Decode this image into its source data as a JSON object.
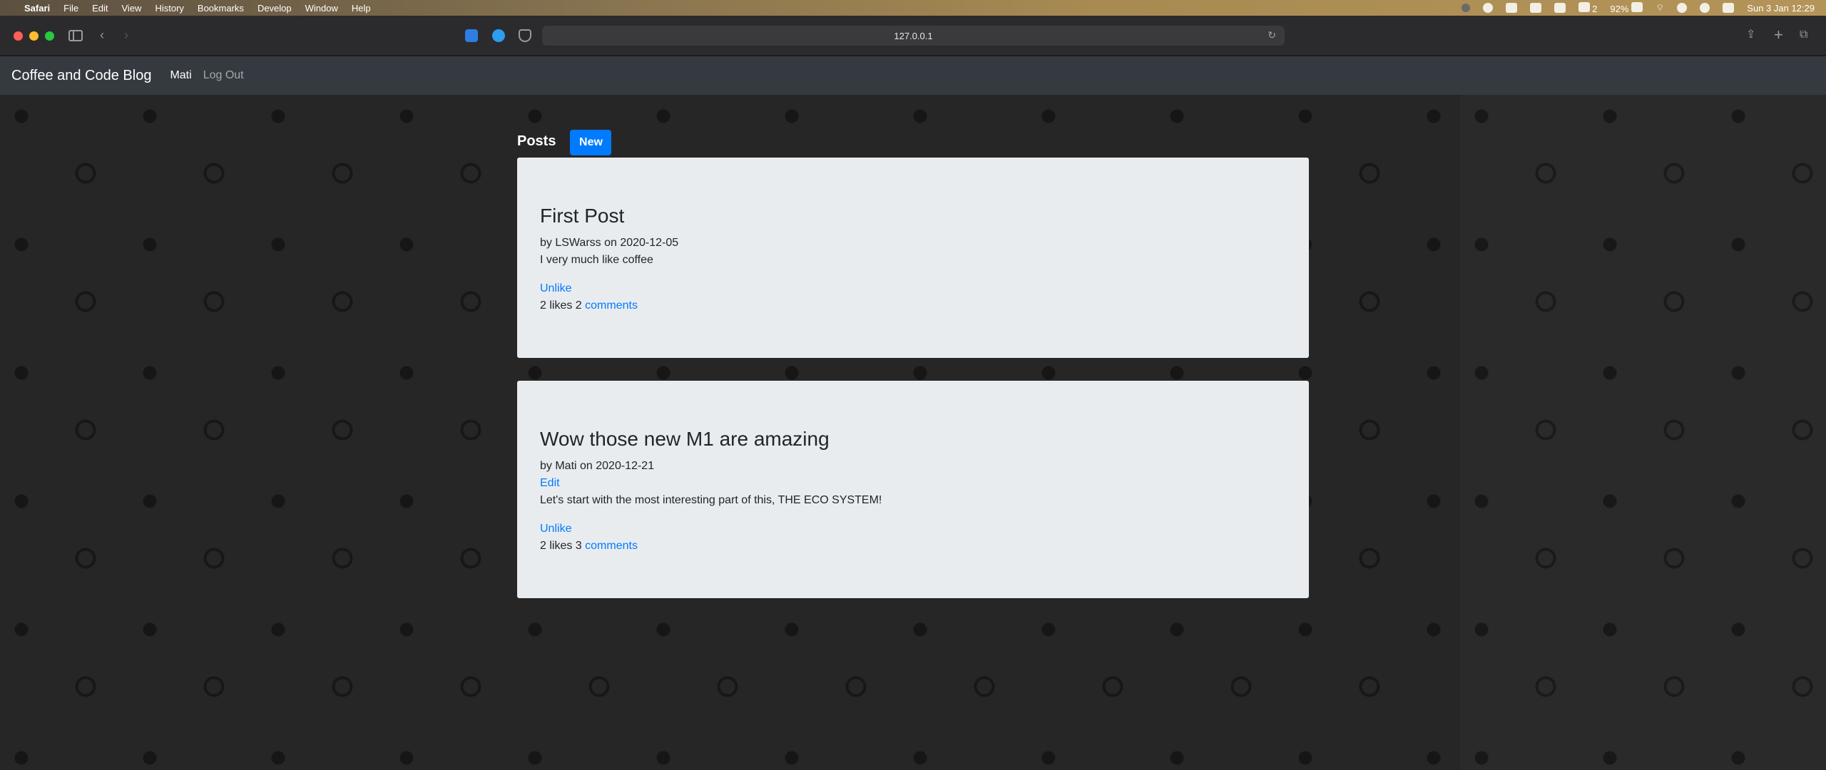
{
  "menubar": {
    "app": "Safari",
    "items": [
      "File",
      "Edit",
      "View",
      "History",
      "Bookmarks",
      "Develop",
      "Window",
      "Help"
    ],
    "status": {
      "count": "2",
      "battery": "92%",
      "datetime": "Sun 3 Jan  12:29"
    }
  },
  "browser": {
    "url": "127.0.0.1"
  },
  "navbar": {
    "brand": "Coffee and Code Blog",
    "user": "Mati",
    "logout": "Log Out"
  },
  "page": {
    "heading": "Posts",
    "new_button": "New"
  },
  "posts": [
    {
      "title": "First Post",
      "meta": "by LSWarss on 2020-12-05",
      "body": "I very much like coffee",
      "like_action": "Unlike",
      "likes_text": "2 likes 2",
      "comments_label": "comments"
    },
    {
      "title": "Wow those new M1 are amazing",
      "meta": "by Mati on 2020-12-21",
      "edit": "Edit",
      "body": "Let's start with the most interesting part of this, THE ECO SYSTEM!",
      "like_action": "Unlike",
      "likes_text": "2 likes 3",
      "comments_label": "comments"
    }
  ],
  "colors": {
    "navbar": "#343a40",
    "primary": "#007bff",
    "card": "#e9ecef"
  }
}
